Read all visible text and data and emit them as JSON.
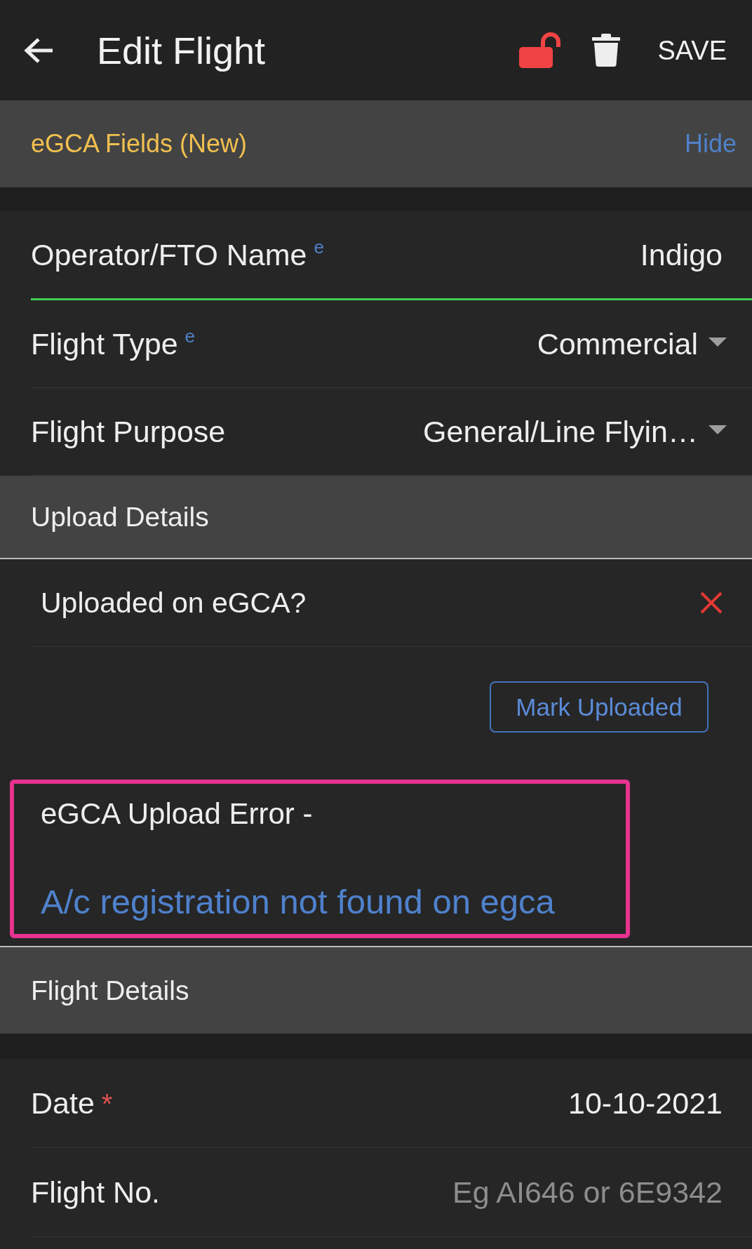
{
  "app_bar": {
    "title": "Edit Flight",
    "locked": false,
    "action": "SAVE"
  },
  "egca_section": {
    "title": "eGCA Fields (New)",
    "toggle": "Hide",
    "fields": [
      {
        "label": "Operator/FTO Name",
        "marker": "e",
        "kind": "text",
        "value": "Indigo",
        "focused": true
      },
      {
        "label": "Flight Type",
        "marker": "e",
        "kind": "dropdown",
        "value": "Commercial",
        "focused": false
      },
      {
        "label": "Flight Purpose",
        "kind": "dropdown",
        "value": "General/Line Flyin…",
        "focused": false
      }
    ]
  },
  "upload_details": {
    "title": "Upload Details",
    "question": "Uploaded on eGCA?",
    "uploaded": false,
    "button": "Mark Uploaded",
    "error": {
      "label": "eGCA Upload Error -",
      "message": "A/c registration not found on egca",
      "highlighted": true
    }
  },
  "flight_details": {
    "title": "Flight Details",
    "fields": [
      {
        "label": "Date",
        "required_mark": "*",
        "kind": "text",
        "value": "10-10-2021",
        "focused": false
      },
      {
        "label": "Flight No.",
        "kind": "text",
        "placeholder": "Eg AI646 or 6E9342",
        "focused": false
      }
    ]
  }
}
